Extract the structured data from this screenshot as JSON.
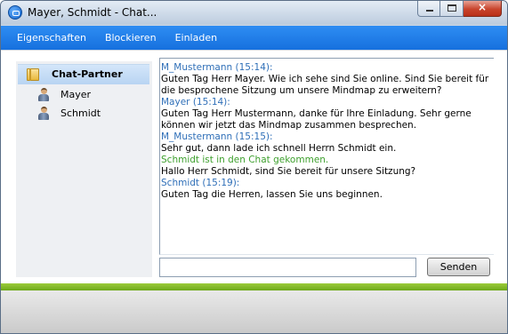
{
  "window": {
    "title": "Mayer, Schmidt - Chat...",
    "app_icon": "teamviewer-icon",
    "controls": {
      "minimize": "minimize-icon",
      "maximize": "maximize-icon",
      "close": "×"
    }
  },
  "menu": {
    "items": [
      {
        "label": "Eigenschaften"
      },
      {
        "label": "Blockieren"
      },
      {
        "label": "Einladen"
      }
    ]
  },
  "sidebar": {
    "title": "Chat-Partner",
    "partners": [
      {
        "name": "Mayer",
        "icon": "user-icon"
      },
      {
        "name": "Schmidt",
        "icon": "user-icon"
      }
    ]
  },
  "chat": {
    "lines": [
      {
        "type": "sender",
        "text": "M_Mustermann (15:14):"
      },
      {
        "type": "msg",
        "text": "Guten Tag Herr Mayer. Wie ich sehe sind Sie online. Sind Sie bereit für die besprochene Sitzung um unsere Mindmap zu erweitern?"
      },
      {
        "type": "sender",
        "text": "Mayer (15:14):"
      },
      {
        "type": "msg",
        "text": "Guten Tag Herr Mustermann, danke für Ihre Einladung. Sehr gerne können wir jetzt das Mindmap zusammen besprechen."
      },
      {
        "type": "sender",
        "text": "M_Mustermann (15:15):"
      },
      {
        "type": "msg",
        "text": "Sehr gut, dann lade ich schnell Herrn Schmidt ein."
      },
      {
        "type": "system",
        "text": "Schmidt ist in den Chat gekommen."
      },
      {
        "type": "msg",
        "text": "Hallo Herr Schmidt, sind Sie bereit für unsere Sitzung?"
      },
      {
        "type": "sender",
        "text": "Schmidt (15:19):"
      },
      {
        "type": "msg",
        "text": "Guten Tag die Herren, lassen Sie uns beginnen."
      }
    ],
    "input_value": "",
    "send_label": "Senden"
  },
  "colors": {
    "menubar": "#1e7fe8",
    "sender": "#2f6fb8",
    "system": "#3ea02e",
    "accent_bar": "#86bc2a"
  }
}
